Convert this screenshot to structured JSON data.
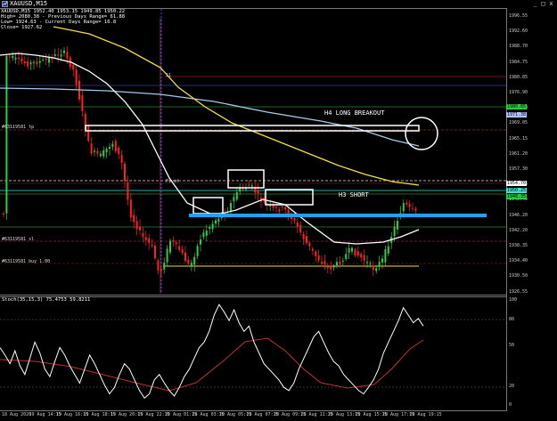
{
  "window": {
    "title": "XAUUSD,M15",
    "buttons": [
      "_",
      "□",
      "x"
    ]
  },
  "info_panel": {
    "lines": [
      "XAUUSD,M15  1952.40 1953.15 1949.85 1950.22",
      "High= 2080.38  - Previous Days Range= 61.88",
      "Low= 1924.63  - Current Days Range= 16.8",
      "Close= 1927.62"
    ]
  },
  "price_axis": {
    "labels": [
      "1996.55",
      "1992.60",
      "1988.70",
      "1984.75",
      "1980.85",
      "1976.90",
      "1973.00",
      "1969.05",
      "1965.15",
      "1961.20",
      "1957.30",
      "1953.35",
      "1949.45",
      "1946.20",
      "1942.20",
      "1938.35",
      "1934.40",
      "1930.50",
      "1926.55"
    ],
    "tags": [
      {
        "text": "1980.85",
        "color": "#2ecc40"
      },
      {
        "text": "1971.38",
        "color": "#b0c4ff"
      },
      {
        "text": "1954.70",
        "color": "#ffffff"
      },
      {
        "text": "1950.25",
        "color": "#40e0d0"
      },
      {
        "text": "1948.35",
        "color": "#2ecc40"
      }
    ]
  },
  "time_axis": {
    "labels": [
      "18 Aug 2020",
      "19 Aug 14:15",
      "19 Aug 16:15",
      "19 Aug 18:15",
      "19 Aug 20:15",
      "19 Aug 22:15",
      "20 Aug 01:15",
      "20 Aug 03:15",
      "20 Aug 05:15",
      "20 Aug 07:15",
      "20 Aug 09:15",
      "20 Aug 11:15",
      "20 Aug 13:15",
      "20 Aug 15:15",
      "20 Aug 17:15",
      "20 Aug 19:15"
    ]
  },
  "level_labels": [
    "#63119581 tp",
    "#63119581 sl",
    "#63119581 buy 1.00",
    "S1",
    "Pivot"
  ],
  "annotations": {
    "h4": "H4 LONG BREAKOUT",
    "h3": "H3 SHORT"
  },
  "stochastic": {
    "label": "Stoch(35,15,3) 75.4753 59.8211",
    "axis": [
      "100",
      "80",
      "50",
      "20",
      "0"
    ],
    "k_values": [
      55,
      48,
      40,
      52,
      38,
      30,
      45,
      60,
      50,
      35,
      28,
      42,
      55,
      48,
      38,
      30,
      22,
      35,
      48,
      40,
      30,
      20,
      12,
      18,
      30,
      40,
      35,
      25,
      15,
      8,
      12,
      25,
      30,
      22,
      15,
      10,
      18,
      28,
      35,
      45,
      55,
      60,
      70,
      85,
      95,
      88,
      80,
      90,
      78,
      70,
      75,
      60,
      50,
      40,
      35,
      30,
      25,
      18,
      15,
      22,
      35,
      45,
      55,
      65,
      70,
      60,
      50,
      42,
      38,
      30,
      25,
      20,
      15,
      12,
      18,
      25,
      35,
      50,
      60,
      70,
      80,
      92,
      85,
      78,
      82,
      75
    ]
  },
  "colors": {
    "bull_candle": "#2ecc40",
    "bear_candle": "#ff2020",
    "ma_yellow": "#f0e040",
    "ma_white": "#ffffff",
    "ma_lightblue": "#a8c8e8",
    "level_blue": "#1fa2ff",
    "sep_blue": "#3050ff",
    "level_red": "#c03030",
    "level_green": "#30a030",
    "stoch_signal": "#c03030"
  }
}
